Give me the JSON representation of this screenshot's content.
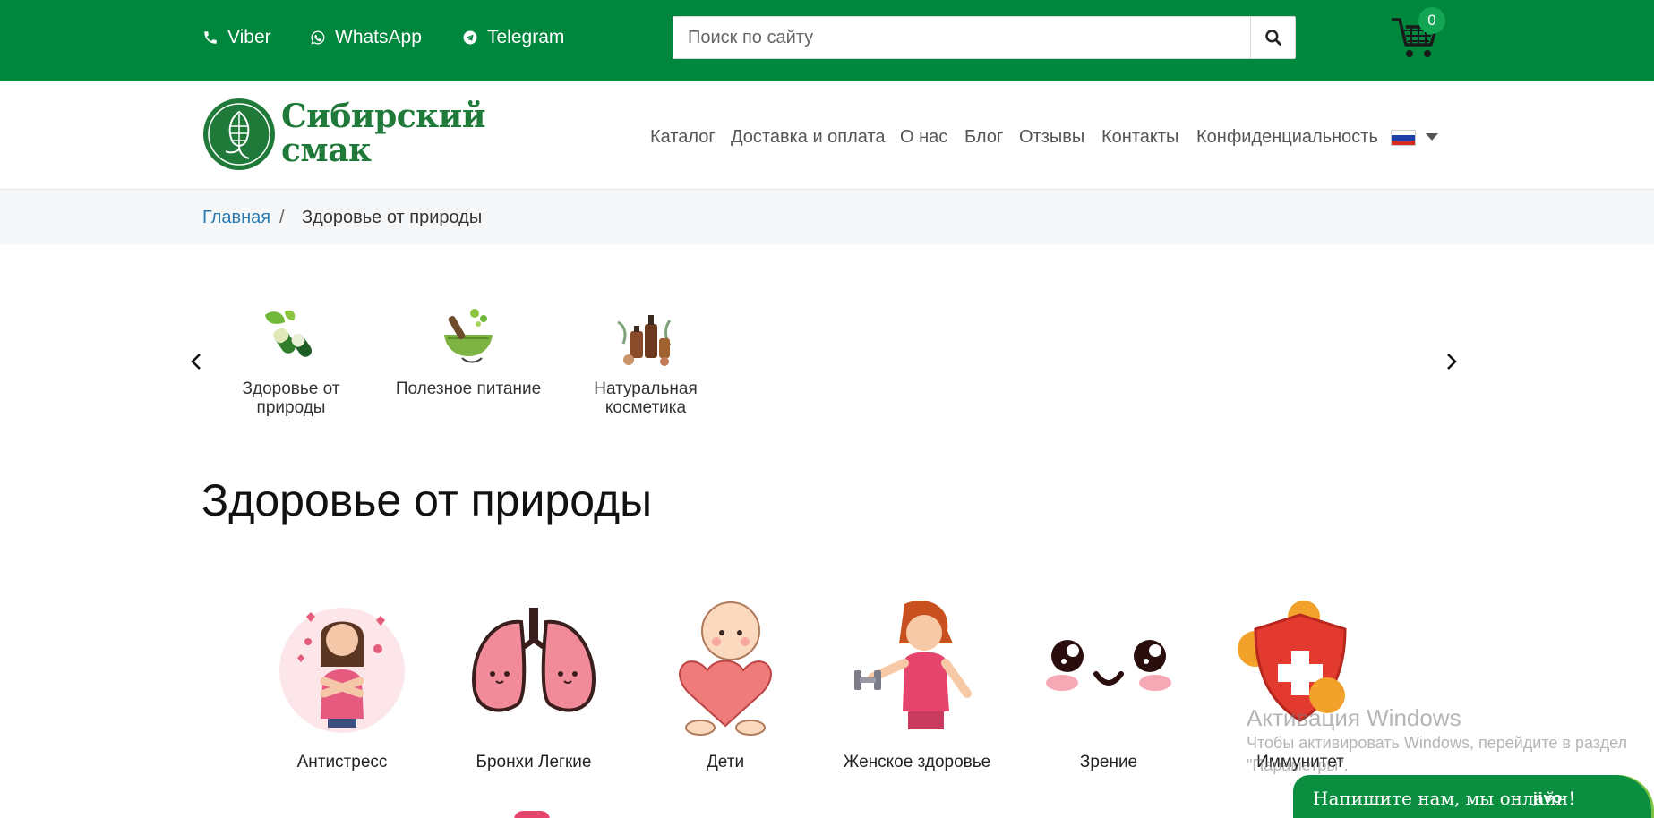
{
  "topbar": {
    "contacts": [
      {
        "label": "Viber",
        "icon": "phone-icon"
      },
      {
        "label": "WhatsApp",
        "icon": "whatsapp-icon"
      },
      {
        "label": "Telegram",
        "icon": "telegram-icon"
      }
    ],
    "search": {
      "placeholder": "Поиск по сайту",
      "value": ""
    },
    "cart": {
      "count": "0"
    }
  },
  "logo": {
    "line1": "Сибирский",
    "line2": "смак"
  },
  "nav": {
    "items": [
      "Каталог",
      "Доставка и оплата",
      "О нас",
      "Блог",
      "Отзывы",
      "Контакты",
      "Конфиденциальность"
    ],
    "language": "ru-flag"
  },
  "breadcrumb": {
    "home": "Главная",
    "separator": "/",
    "current": "Здоровье от природы"
  },
  "categories": [
    {
      "label": "Здоровье от природы",
      "icon": "capsules-leaf-icon"
    },
    {
      "label": "Полезное питание",
      "icon": "mortar-herbs-icon"
    },
    {
      "label": "Натуральная косметика",
      "icon": "cosmetics-bottles-icon"
    }
  ],
  "page_title": "Здоровье от природы",
  "subcategories": [
    {
      "label": "Антистресс"
    },
    {
      "label": "Бронхи Легкие"
    },
    {
      "label": "Дети"
    },
    {
      "label": "Женское здоровье"
    },
    {
      "label": "Зрение"
    },
    {
      "label": "Иммунитет"
    }
  ],
  "watermark": {
    "title": "Активация Windows",
    "line1": "Чтобы активировать Windows, перейдите в раздел",
    "line2": "\"Параметры\"."
  },
  "chat": {
    "label": "Напишите нам, мы онлайн!",
    "brand": "jivo"
  },
  "colors": {
    "primary": "#00873e",
    "link": "#2a7ab0",
    "chat": "#0b8e3f"
  }
}
